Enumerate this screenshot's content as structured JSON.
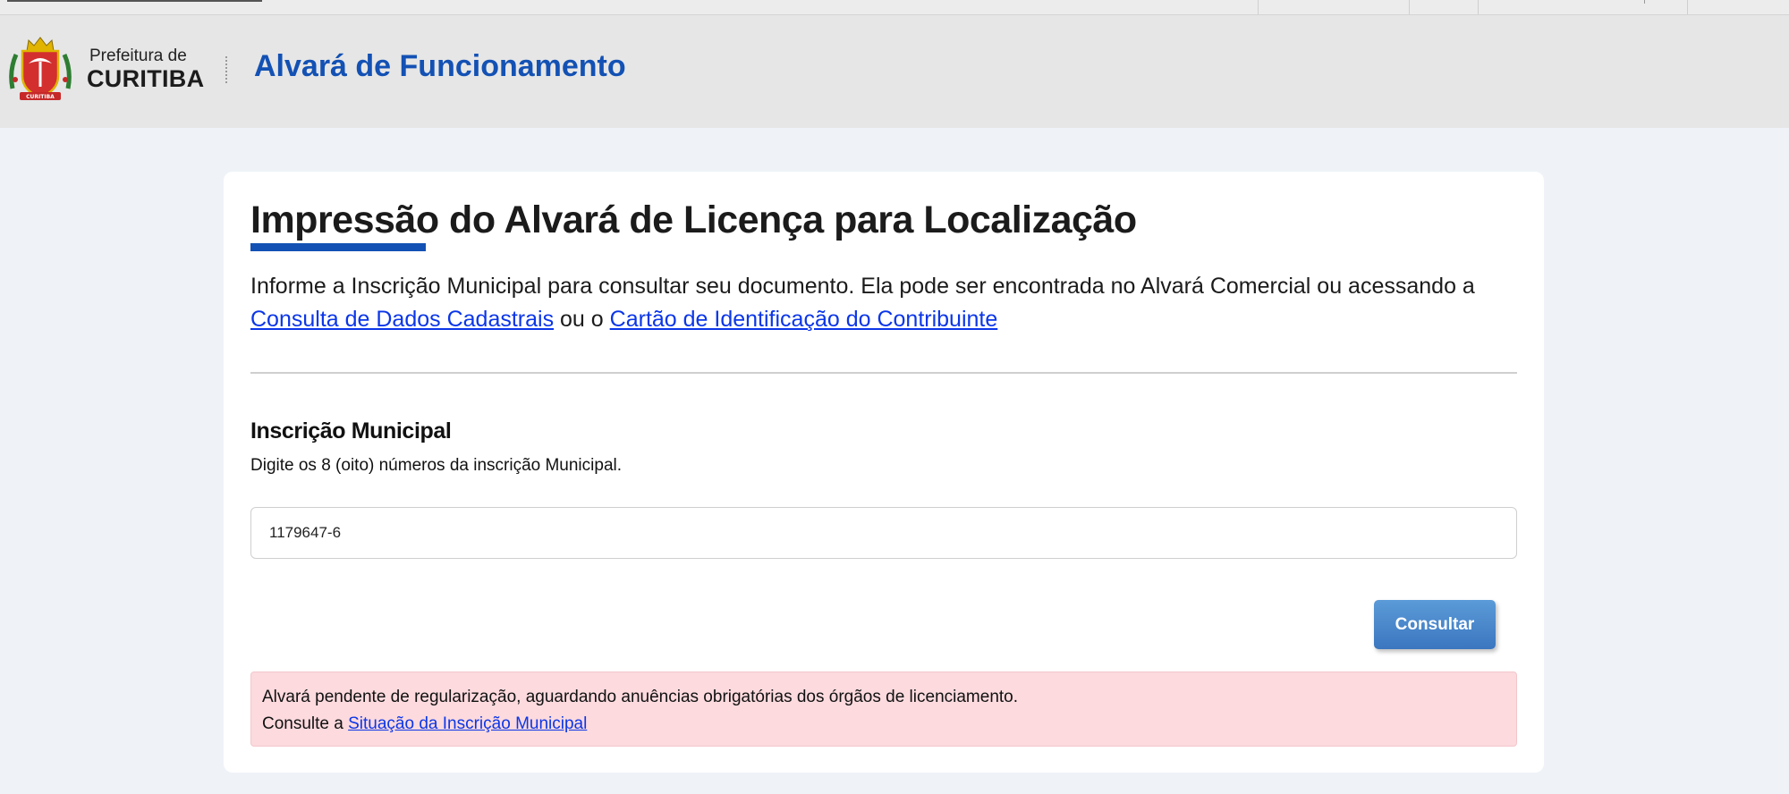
{
  "header": {
    "logo_top": "Prefeitura de",
    "logo_main": "CURITIBA",
    "crest_banner_text": "CURITIBA",
    "system_title": "Alvará de Funcionamento"
  },
  "main": {
    "title": "Impressão do Alvará de Licença para Localização",
    "intro_text": "Informe a Inscrição Municipal para consultar seu documento. Ela pode ser encontrada no Alvará Comercial ou acessando a",
    "link_dados_cadastrais": "Consulta de Dados Cadastrais",
    "intro_or": "ou o",
    "link_cartao": "Cartão de Identificação do Contribuinte",
    "field_label": "Inscrição Municipal",
    "field_help": "Digite os 8 (oito) números da inscrição Municipal.",
    "field_value": "1179647-6",
    "button_label": "Consultar",
    "alert_line1": "Alvará pendente de regularização, aguardando anuências obrigatórias dos órgãos de licenciamento.",
    "alert_line2_prefix": "Consulte a",
    "alert_link": "Situação da Inscrição Municipal"
  },
  "colors": {
    "brand_blue": "#1351b4",
    "link_blue": "#0b36e8",
    "alert_bg": "#fcdade",
    "page_bg": "#eff3f8",
    "header_bg": "#e6e6e6"
  }
}
